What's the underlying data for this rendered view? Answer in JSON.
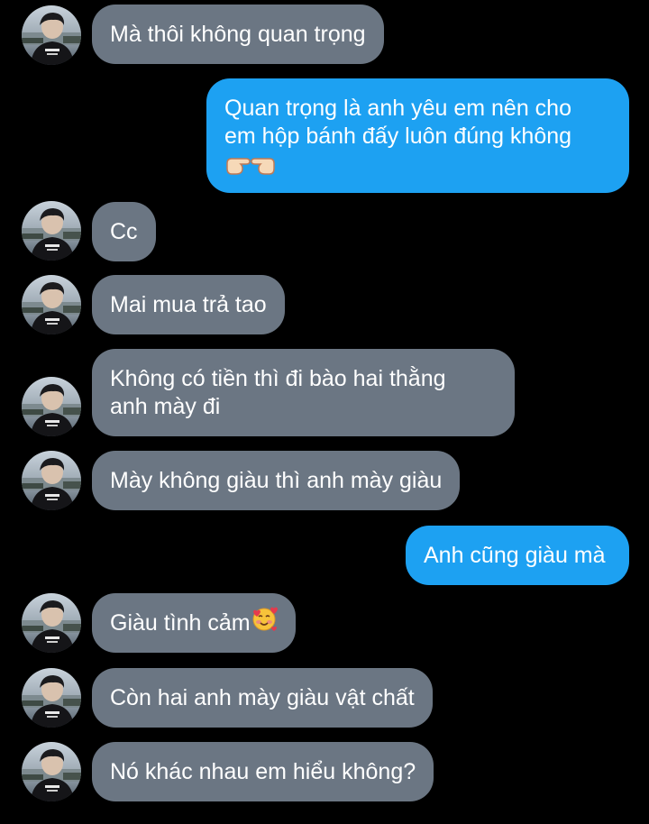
{
  "messages": [
    {
      "side": "in",
      "text": "Mà thôi không quan trọng"
    },
    {
      "side": "out",
      "line1": "Quan trọng là anh yêu em nên cho",
      "line2": "em hộp bánh đấy luôn đúng không",
      "emoji": "pointing-hands-emoji"
    },
    {
      "side": "in",
      "text": "Cc"
    },
    {
      "side": "in",
      "text": "Mai mua trả tao"
    },
    {
      "side": "in",
      "line1": "Không có tiền thì đi bào hai thằng",
      "line2": "anh mày đi"
    },
    {
      "side": "in",
      "text": "Mày không giàu thì anh mày giàu"
    },
    {
      "side": "out",
      "text": "Anh cũng giàu mà"
    },
    {
      "side": "in",
      "text": "Giàu tình cảm",
      "emoji": "smiling-face-with-hearts-emoji"
    },
    {
      "side": "in",
      "text": "Còn hai anh mày giàu vật chất"
    },
    {
      "side": "in",
      "text": "Nó khác nhau em hiểu không?"
    }
  ],
  "colors": {
    "background": "#000000",
    "incoming_bubble": "#6b7683",
    "outgoing_bubble": "#1da1f2",
    "text": "#ffffff"
  }
}
